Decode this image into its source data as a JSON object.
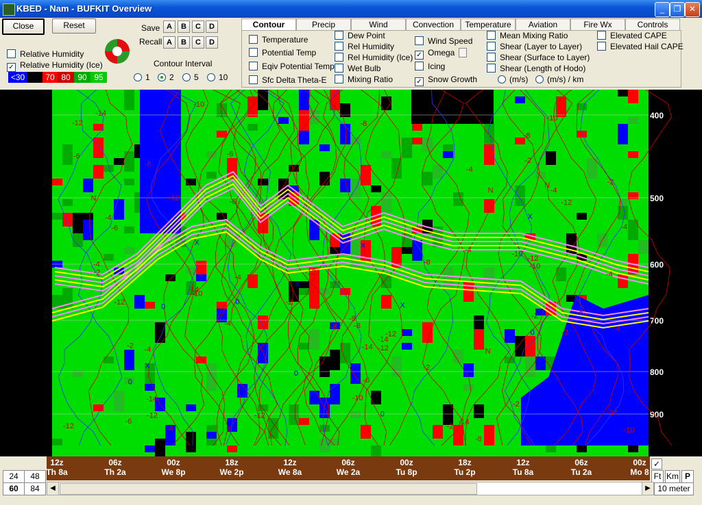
{
  "window": {
    "title": "KBED - Nam - BUFKIT Overview",
    "min": "_",
    "max": "❐",
    "close": "✕"
  },
  "toolbar": {
    "close_label": "Close",
    "reset_label": "Reset",
    "save_label": "Save",
    "recall_label": "Recall",
    "slot_labels": [
      "A",
      "B",
      "C",
      "D"
    ],
    "contour_interval_label": "Contour Interval",
    "contour_intervals": [
      "1",
      "2",
      "5",
      "10"
    ],
    "contour_selected": "2",
    "checks": [
      {
        "label": "Relative Humidity",
        "checked": false
      },
      {
        "label": "Relative Humidity (Ice)",
        "checked": true
      }
    ],
    "swatches": [
      {
        "label": "<30",
        "color": "#0000ff"
      },
      {
        "label": "",
        "color": "#000000"
      },
      {
        "label": "70",
        "color": "#ff0000"
      },
      {
        "label": "80",
        "color": "#cc0000"
      },
      {
        "label": "90",
        "color": "#00aa00"
      },
      {
        "label": "95",
        "color": "#00cc00"
      }
    ]
  },
  "tabs": [
    "Contour",
    "Precip",
    "Wind",
    "Convection",
    "Temperature",
    "Aviation",
    "Fire Wx",
    "Controls"
  ],
  "active_tab": "Contour",
  "contour_options": {
    "col1": [
      {
        "label": "Temperature",
        "checked": false
      },
      {
        "label": "Potential Temp",
        "checked": false
      },
      {
        "label": "Eqiv Potential Temp",
        "checked": false
      },
      {
        "label": "Sfc Delta Theta-E",
        "checked": false
      }
    ],
    "col2": [
      {
        "label": "Dew Point",
        "checked": false
      },
      {
        "label": "Rel Humidity",
        "checked": false
      },
      {
        "label": "Rel Humidity (Ice)",
        "checked": false
      },
      {
        "label": "Wet Bulb",
        "checked": false
      },
      {
        "label": "Mixing Ratio",
        "checked": false
      }
    ],
    "col3": [
      {
        "label": "Wind Speed",
        "checked": false
      },
      {
        "label": "Omega",
        "checked": true
      },
      {
        "label": "Icing",
        "checked": false
      },
      {
        "label": "Snow Growth",
        "checked": true
      }
    ],
    "col4": [
      {
        "label": "Mean Mixing Ratio",
        "checked": false
      },
      {
        "label": "Shear (Layer to Layer)",
        "checked": false
      },
      {
        "label": "Shear (Surface to Layer)",
        "checked": false
      },
      {
        "label": "Shear (Length of Hodo)",
        "checked": false
      }
    ],
    "units": [
      "(m/s)",
      "(m/s) / km"
    ],
    "col5": [
      {
        "label": "Elevated CAPE",
        "checked": false
      },
      {
        "label": "Elevated Hail CAPE",
        "checked": false
      }
    ]
  },
  "plot": {
    "pressure_levels": [
      "400",
      "500",
      "600",
      "700",
      "800",
      "900"
    ],
    "contour_labels": [
      "-2",
      "-4",
      "-6",
      "-8",
      "-10",
      "-12",
      "-14",
      "N",
      "0",
      "X"
    ]
  },
  "time_axis": {
    "ticks": [
      {
        "top": "12z",
        "bottom": "Th 8a"
      },
      {
        "top": "06z",
        "bottom": "Th 2a"
      },
      {
        "top": "00z",
        "bottom": "We 8p"
      },
      {
        "top": "18z",
        "bottom": "We 2p"
      },
      {
        "top": "12z",
        "bottom": "We 8a"
      },
      {
        "top": "06z",
        "bottom": "We 2a"
      },
      {
        "top": "00z",
        "bottom": "Tu 8p"
      },
      {
        "top": "18z",
        "bottom": "Tu 2p"
      },
      {
        "top": "12z",
        "bottom": "Tu 8a"
      },
      {
        "top": "06z",
        "bottom": "Tu 2a"
      },
      {
        "top": "00z",
        "bottom": "Mo 8"
      }
    ]
  },
  "bottom": {
    "hours": [
      "24",
      "48",
      "60",
      "84"
    ],
    "hours_selected": "60",
    "units": [
      "Ft",
      "Km",
      "P"
    ],
    "level_label": "10 meter",
    "check_mark": "✓"
  }
}
